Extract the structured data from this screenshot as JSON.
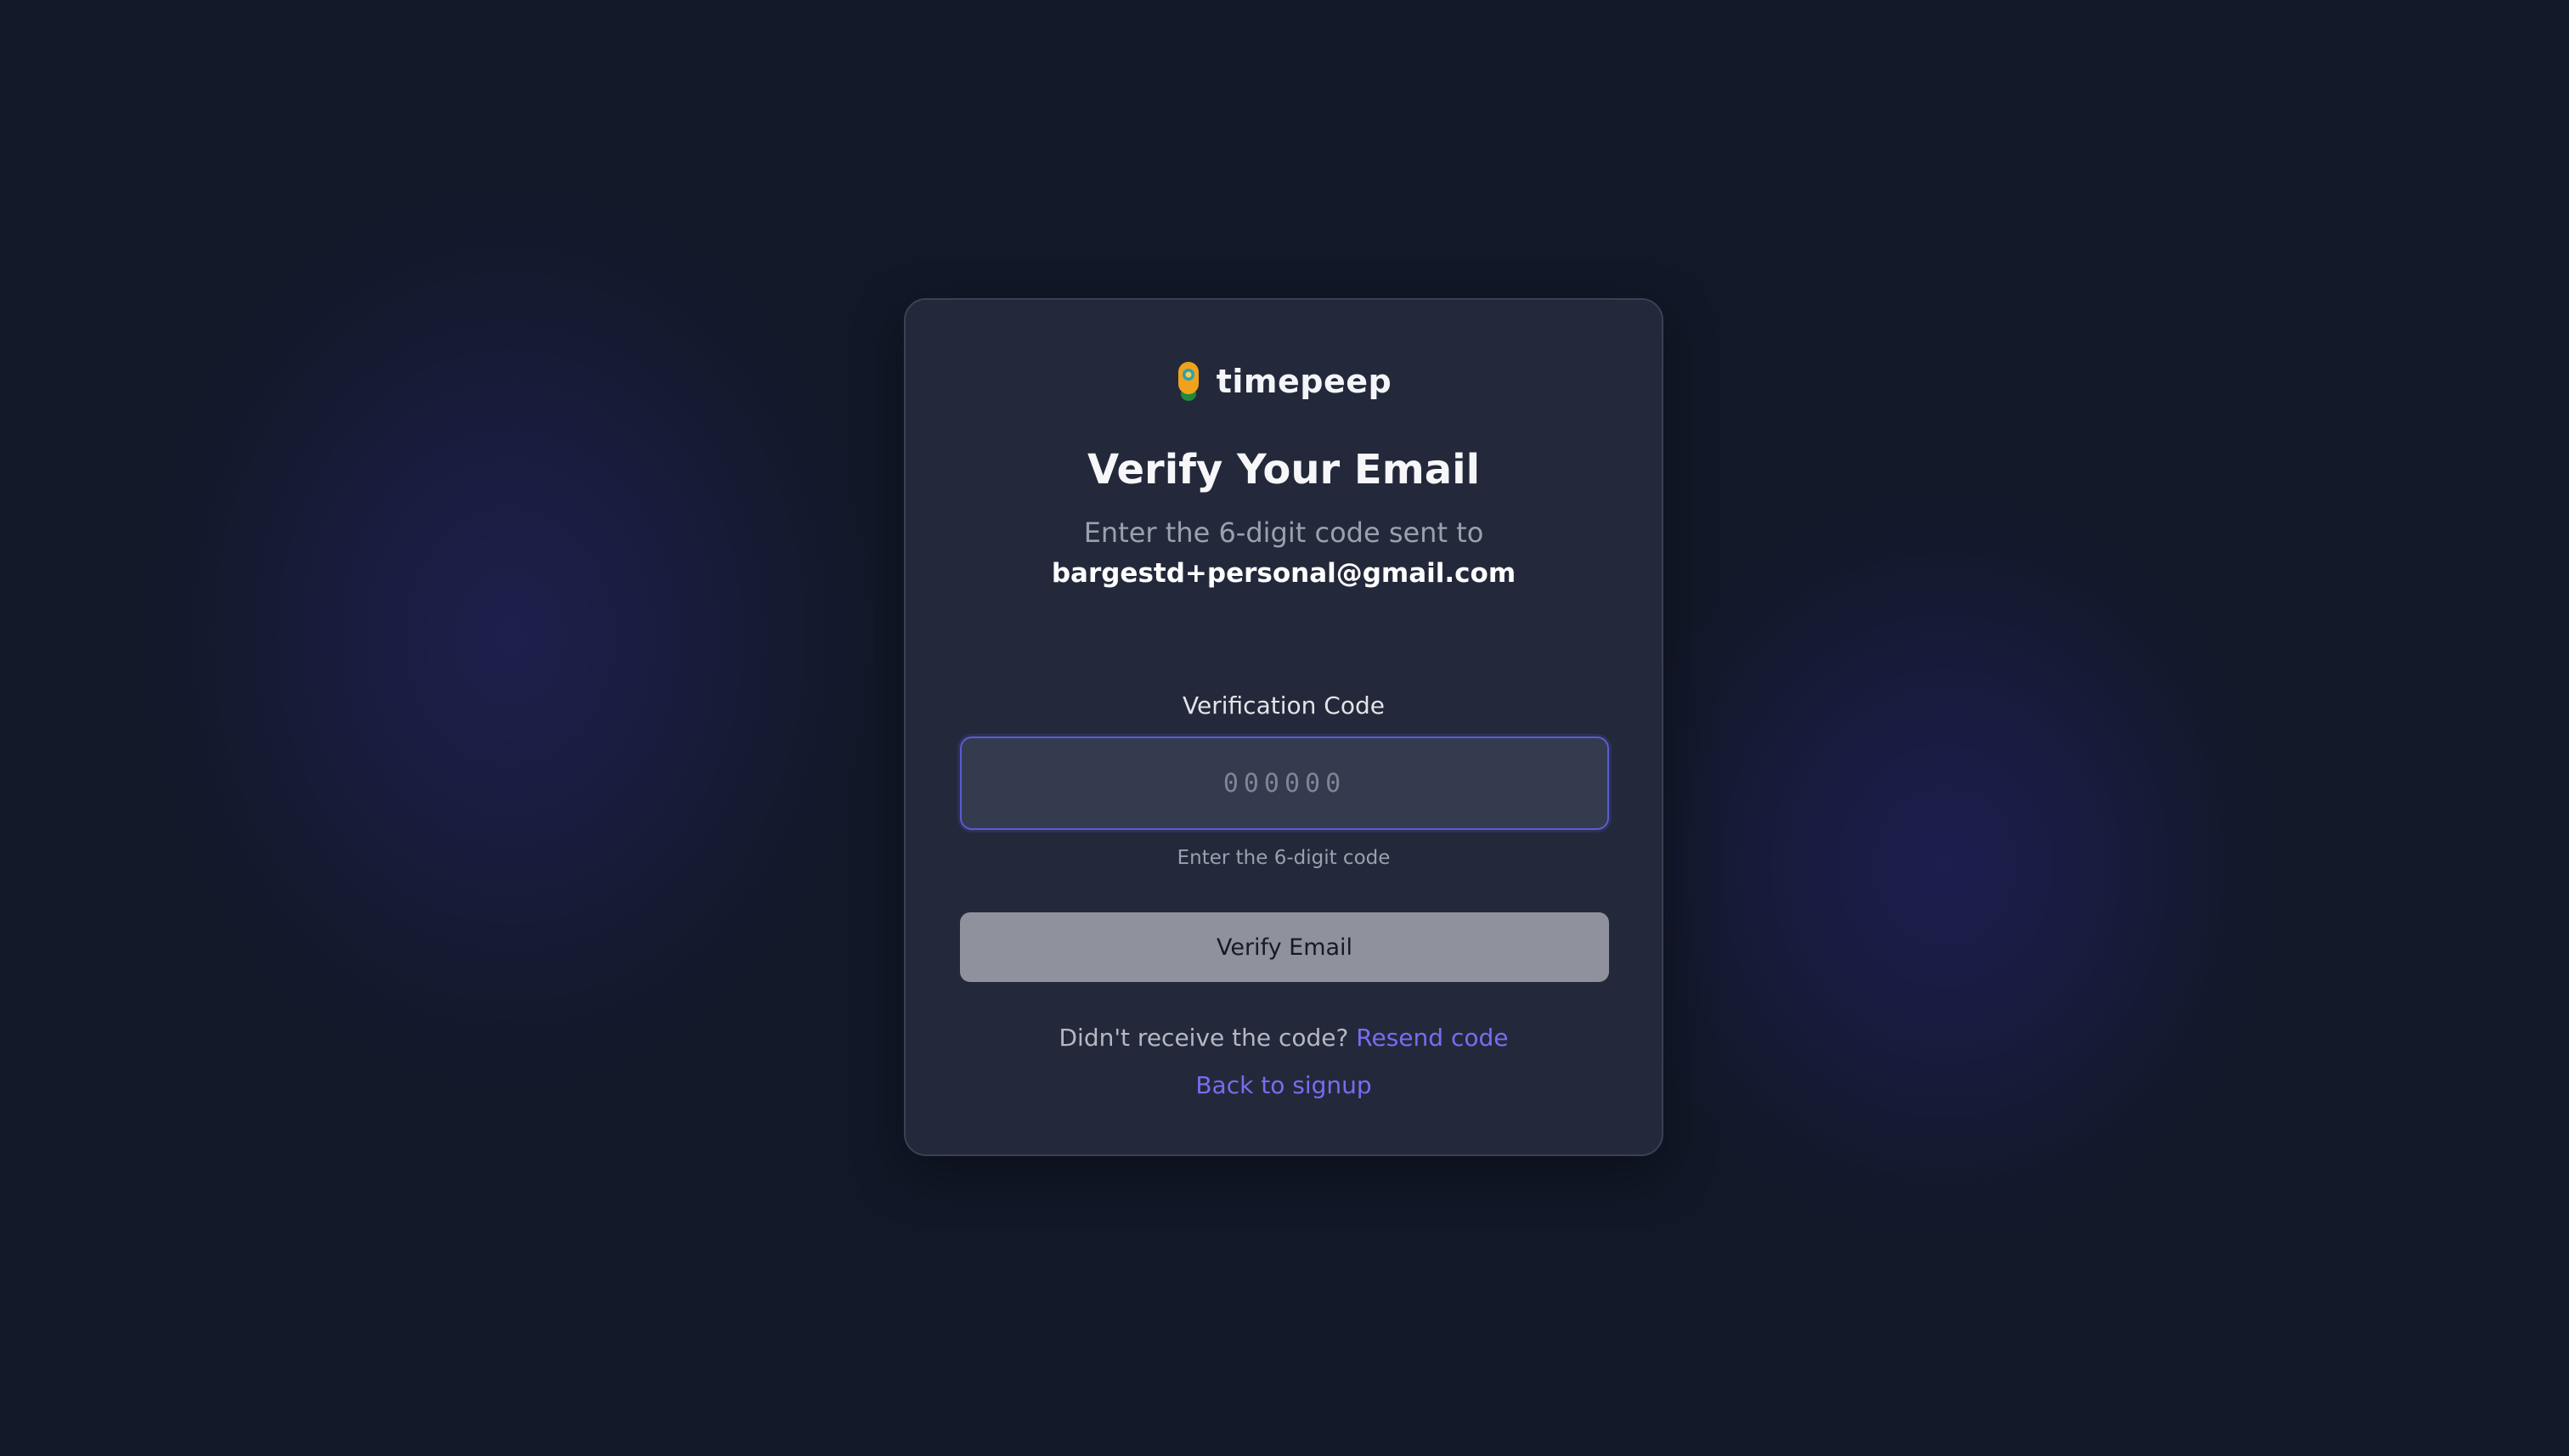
{
  "brand": {
    "name": "timepeep",
    "logo_icon": "peep-flower-icon"
  },
  "heading": {
    "title": "Verify Your Email",
    "subtitle": "Enter the 6-digit code sent to",
    "email": "bargestd+personal@gmail.com"
  },
  "form": {
    "code_label": "Verification Code",
    "code_value": "",
    "code_placeholder": "000000",
    "code_hint": "Enter the 6-digit code",
    "submit_label": "Verify Email"
  },
  "footer": {
    "resend_prompt": "Didn't receive the code?",
    "resend_link": "Resend code",
    "back_link": "Back to signup"
  },
  "colors": {
    "background": "#111827",
    "card": "#242a3b",
    "accent": "#7a6cf0",
    "input_focus_border": "#5b5bd6",
    "button_disabled": "#8f929c"
  }
}
